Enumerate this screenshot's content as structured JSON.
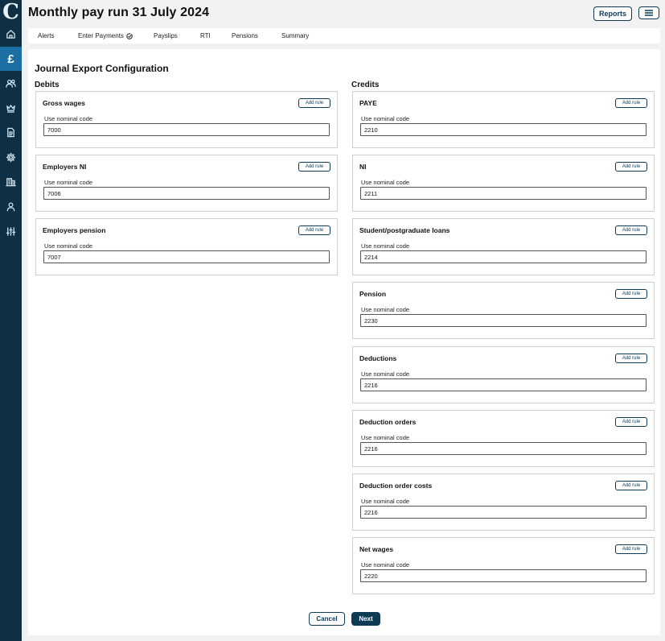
{
  "app": {
    "logo": "C"
  },
  "header": {
    "title": "Monthly pay run 31 July 2024",
    "reports_label": "Reports"
  },
  "tabs": [
    {
      "label": "Alerts"
    },
    {
      "label": "Enter Payments"
    },
    {
      "label": "Payslips"
    },
    {
      "label": "RTI"
    },
    {
      "label": "Pensions"
    },
    {
      "label": "Summary"
    }
  ],
  "sidebar": {
    "active_symbol": "£"
  },
  "page": {
    "title": "Journal Export Configuration",
    "debits_heading": "Debits",
    "credits_heading": "Credits",
    "field_label": "Use nominal code",
    "add_rule_label": "Add rule"
  },
  "debits": [
    {
      "name": "Gross wages",
      "code": "7000"
    },
    {
      "name": "Employers NI",
      "code": "7006"
    },
    {
      "name": "Employers pension",
      "code": "7007"
    }
  ],
  "credits": [
    {
      "name": "PAYE",
      "code": "2210"
    },
    {
      "name": "NI",
      "code": "2211"
    },
    {
      "name": "Student/postgraduate loans",
      "code": "2214"
    },
    {
      "name": "Pension",
      "code": "2230"
    },
    {
      "name": "Deductions",
      "code": "2216"
    },
    {
      "name": "Deduction orders",
      "code": "2216"
    },
    {
      "name": "Deduction order costs",
      "code": "2216"
    },
    {
      "name": "Net wages",
      "code": "2220"
    }
  ],
  "footer": {
    "cancel_label": "Cancel",
    "next_label": "Next"
  },
  "colors": {
    "sidebar": "#0e2f44",
    "sidebar_active": "#1c6fa2",
    "accent": "#0e3a55"
  }
}
